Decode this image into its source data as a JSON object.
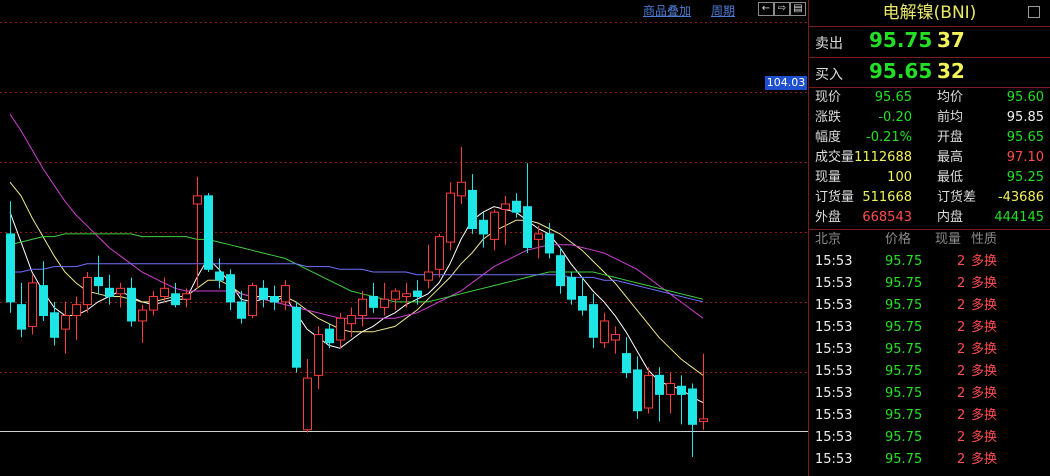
{
  "toolbar": {
    "overlay_label": "商品叠加",
    "period_label": "周期",
    "nav_buttons": [
      "←",
      "⇨",
      "▤"
    ]
  },
  "price_tag": "104.03",
  "quote": {
    "title": "电解镍(BNI)",
    "sell_label": "卖出",
    "sell_price": "95.75",
    "sell_vol": "37",
    "buy_label": "买入",
    "buy_price": "95.65",
    "buy_vol": "32"
  },
  "stats": [
    {
      "l1": "现价",
      "v1": "95.65",
      "c1": "green",
      "l2": "均价",
      "v2": "95.60",
      "c2": "green"
    },
    {
      "l1": "涨跌",
      "v1": "-0.20",
      "c1": "green",
      "l2": "前均",
      "v2": "95.85",
      "c2": "white"
    },
    {
      "l1": "幅度",
      "v1": "-0.21%",
      "c1": "green",
      "l2": "开盘",
      "v2": "95.65",
      "c2": "green"
    },
    {
      "l1": "成交量",
      "v1": "1112688",
      "c1": "yellow",
      "l2": "最高",
      "v2": "97.10",
      "c2": "red"
    },
    {
      "l1": "现量",
      "v1": "100",
      "c1": "yellow",
      "l2": "最低",
      "v2": "95.25",
      "c2": "green"
    },
    {
      "l1": "订货量",
      "v1": "511668",
      "c1": "yellow",
      "l2": "订货差",
      "v2": "-43686",
      "c2": "yellow"
    },
    {
      "l1": "外盘",
      "v1": "668543",
      "c1": "red",
      "l2": "内盘",
      "v2": "444145",
      "c2": "green"
    }
  ],
  "trades_header": {
    "time": "北京",
    "price": "价格",
    "vol": "现量",
    "type": "性质"
  },
  "trades": [
    {
      "time": "15:53",
      "price": "95.75",
      "vol": "2",
      "type": "多换"
    },
    {
      "time": "15:53",
      "price": "95.75",
      "vol": "2",
      "type": "多换"
    },
    {
      "time": "15:53",
      "price": "95.75",
      "vol": "2",
      "type": "多换"
    },
    {
      "time": "15:53",
      "price": "95.75",
      "vol": "2",
      "type": "多换"
    },
    {
      "time": "15:53",
      "price": "95.75",
      "vol": "2",
      "type": "多换"
    },
    {
      "time": "15:53",
      "price": "95.75",
      "vol": "2",
      "type": "多换"
    },
    {
      "time": "15:53",
      "price": "95.75",
      "vol": "2",
      "type": "多换"
    },
    {
      "time": "15:53",
      "price": "95.75",
      "vol": "2",
      "type": "多换"
    },
    {
      "time": "15:53",
      "price": "95.75",
      "vol": "2",
      "type": "多换"
    },
    {
      "time": "15:53",
      "price": "95.75",
      "vol": "2",
      "type": "多换"
    }
  ],
  "colors": {
    "up": "#ff3b3b",
    "down": "#1fe6e6",
    "ma5": "#ffffff",
    "ma10": "#f0e68c",
    "ma20": "#d040d0",
    "ma40": "#40d040",
    "ma60": "#7070ff"
  },
  "chart_data": {
    "type": "candlestick",
    "y_range": [
      88.5,
      106.0
    ],
    "reference_price": 104.03,
    "candles": [
      {
        "o": 97.4,
        "h": 98.6,
        "l": 94.5,
        "c": 94.9
      },
      {
        "o": 94.8,
        "h": 95.6,
        "l": 93.6,
        "c": 93.9
      },
      {
        "o": 94.0,
        "h": 95.9,
        "l": 93.7,
        "c": 95.6
      },
      {
        "o": 95.5,
        "h": 96.4,
        "l": 94.2,
        "c": 94.4
      },
      {
        "o": 94.5,
        "h": 94.9,
        "l": 93.3,
        "c": 93.6
      },
      {
        "o": 93.9,
        "h": 94.9,
        "l": 93.0,
        "c": 94.4
      },
      {
        "o": 94.4,
        "h": 95.1,
        "l": 93.5,
        "c": 94.8
      },
      {
        "o": 94.8,
        "h": 96.0,
        "l": 94.5,
        "c": 95.8
      },
      {
        "o": 95.8,
        "h": 96.6,
        "l": 95.2,
        "c": 95.5
      },
      {
        "o": 95.4,
        "h": 95.9,
        "l": 94.8,
        "c": 95.1
      },
      {
        "o": 95.2,
        "h": 95.6,
        "l": 94.7,
        "c": 95.4
      },
      {
        "o": 95.4,
        "h": 95.8,
        "l": 94.0,
        "c": 94.2
      },
      {
        "o": 94.2,
        "h": 94.8,
        "l": 93.4,
        "c": 94.6
      },
      {
        "o": 94.6,
        "h": 95.3,
        "l": 94.4,
        "c": 95.1
      },
      {
        "o": 95.1,
        "h": 95.8,
        "l": 94.9,
        "c": 95.4
      },
      {
        "o": 95.2,
        "h": 95.6,
        "l": 94.7,
        "c": 94.8
      },
      {
        "o": 95.0,
        "h": 95.4,
        "l": 94.7,
        "c": 95.2
      },
      {
        "o": 98.5,
        "h": 99.5,
        "l": 95.4,
        "c": 98.8
      },
      {
        "o": 98.8,
        "h": 98.9,
        "l": 96.0,
        "c": 96.1
      },
      {
        "o": 96.0,
        "h": 96.5,
        "l": 95.4,
        "c": 95.7
      },
      {
        "o": 95.9,
        "h": 96.1,
        "l": 94.6,
        "c": 94.9
      },
      {
        "o": 94.9,
        "h": 95.3,
        "l": 94.1,
        "c": 94.3
      },
      {
        "o": 94.4,
        "h": 95.6,
        "l": 94.3,
        "c": 95.5
      },
      {
        "o": 95.4,
        "h": 95.7,
        "l": 94.7,
        "c": 95.0
      },
      {
        "o": 95.1,
        "h": 95.5,
        "l": 94.6,
        "c": 94.9
      },
      {
        "o": 94.9,
        "h": 95.7,
        "l": 94.6,
        "c": 95.5
      },
      {
        "o": 94.7,
        "h": 94.9,
        "l": 92.3,
        "c": 92.5
      },
      {
        "o": 90.2,
        "h": 92.8,
        "l": 90.1,
        "c": 92.1
      },
      {
        "o": 92.2,
        "h": 94.0,
        "l": 91.7,
        "c": 93.7
      },
      {
        "o": 93.9,
        "h": 94.1,
        "l": 93.2,
        "c": 93.4
      },
      {
        "o": 93.5,
        "h": 94.5,
        "l": 93.2,
        "c": 94.3
      },
      {
        "o": 94.1,
        "h": 94.7,
        "l": 93.6,
        "c": 94.4
      },
      {
        "o": 94.4,
        "h": 95.3,
        "l": 94.0,
        "c": 95.0
      },
      {
        "o": 95.1,
        "h": 95.6,
        "l": 94.5,
        "c": 94.7
      },
      {
        "o": 94.7,
        "h": 95.6,
        "l": 94.4,
        "c": 95.0
      },
      {
        "o": 95.0,
        "h": 95.4,
        "l": 94.6,
        "c": 95.3
      },
      {
        "o": 95.1,
        "h": 95.6,
        "l": 94.7,
        "c": 95.2
      },
      {
        "o": 95.3,
        "h": 95.7,
        "l": 94.8,
        "c": 95.1
      },
      {
        "o": 95.7,
        "h": 97.0,
        "l": 95.4,
        "c": 96.0
      },
      {
        "o": 96.1,
        "h": 97.4,
        "l": 95.8,
        "c": 97.3
      },
      {
        "o": 97.1,
        "h": 99.3,
        "l": 96.8,
        "c": 98.9
      },
      {
        "o": 98.8,
        "h": 100.6,
        "l": 98.5,
        "c": 99.3
      },
      {
        "o": 99.0,
        "h": 99.6,
        "l": 97.4,
        "c": 97.6
      },
      {
        "o": 97.9,
        "h": 98.2,
        "l": 96.9,
        "c": 97.4
      },
      {
        "o": 97.2,
        "h": 98.3,
        "l": 96.8,
        "c": 98.2
      },
      {
        "o": 98.3,
        "h": 98.8,
        "l": 97.0,
        "c": 98.5
      },
      {
        "o": 98.6,
        "h": 98.9,
        "l": 98.0,
        "c": 98.2
      },
      {
        "o": 98.4,
        "h": 100.0,
        "l": 96.7,
        "c": 96.9
      },
      {
        "o": 97.2,
        "h": 97.7,
        "l": 96.5,
        "c": 97.4
      },
      {
        "o": 97.4,
        "h": 97.8,
        "l": 96.5,
        "c": 96.7
      },
      {
        "o": 96.6,
        "h": 96.9,
        "l": 95.2,
        "c": 95.5
      },
      {
        "o": 95.8,
        "h": 96.0,
        "l": 94.8,
        "c": 95.0
      },
      {
        "o": 95.1,
        "h": 95.8,
        "l": 94.4,
        "c": 94.6
      },
      {
        "o": 94.8,
        "h": 95.2,
        "l": 93.2,
        "c": 93.6
      },
      {
        "o": 93.4,
        "h": 94.5,
        "l": 93.2,
        "c": 94.2
      },
      {
        "o": 93.5,
        "h": 94.0,
        "l": 93.0,
        "c": 93.7
      },
      {
        "o": 93.0,
        "h": 93.6,
        "l": 92.1,
        "c": 92.3
      },
      {
        "o": 92.4,
        "h": 92.9,
        "l": 90.6,
        "c": 90.9
      },
      {
        "o": 91.0,
        "h": 92.5,
        "l": 90.8,
        "c": 92.2
      },
      {
        "o": 92.2,
        "h": 92.5,
        "l": 90.5,
        "c": 91.5
      },
      {
        "o": 91.5,
        "h": 92.3,
        "l": 90.8,
        "c": 91.9
      },
      {
        "o": 91.8,
        "h": 92.2,
        "l": 90.4,
        "c": 91.5
      },
      {
        "o": 91.7,
        "h": 91.9,
        "l": 89.2,
        "c": 90.4
      },
      {
        "o": 90.5,
        "h": 93.0,
        "l": 90.2,
        "c": 90.6
      }
    ],
    "ma_lines": [
      {
        "name": "MA5",
        "color_key": "ma5",
        "values": [
          98.2,
          97.1,
          96.0,
          95.3,
          94.7,
          94.4,
          94.4,
          94.6,
          94.9,
          95.1,
          95.3,
          95.1,
          94.9,
          94.8,
          94.9,
          95.0,
          95.0,
          95.8,
          96.5,
          96.1,
          95.6,
          95.0,
          94.9,
          95.0,
          94.9,
          95.1,
          94.5,
          93.9,
          93.6,
          93.3,
          93.2,
          93.5,
          93.8,
          94.0,
          94.3,
          94.5,
          94.8,
          95.0,
          95.2,
          95.6,
          96.3,
          97.2,
          97.9,
          98.2,
          98.4,
          98.3,
          98.2,
          97.9,
          97.6,
          97.4,
          96.9,
          96.3,
          95.8,
          95.3,
          94.9,
          94.4,
          93.8,
          93.1,
          92.4,
          92.0,
          91.8,
          91.7,
          91.4,
          91.2
        ]
      },
      {
        "name": "MA10",
        "color_key": "ma10",
        "values": [
          99.3,
          98.8,
          98.0,
          97.3,
          96.6,
          96.0,
          95.6,
          95.3,
          95.2,
          95.1,
          95.1,
          95.0,
          94.9,
          94.9,
          95.0,
          95.1,
          95.1,
          95.4,
          95.7,
          95.7,
          95.5,
          95.2,
          95.1,
          95.1,
          95.1,
          95.1,
          94.9,
          94.6,
          94.3,
          94.1,
          93.9,
          93.8,
          93.8,
          93.8,
          93.9,
          94.0,
          94.3,
          94.6,
          95.0,
          95.4,
          95.8,
          96.3,
          96.7,
          97.2,
          97.5,
          97.7,
          97.9,
          97.9,
          97.8,
          97.6,
          97.4,
          97.1,
          96.8,
          96.4,
          96.0,
          95.6,
          95.1,
          94.6,
          94.1,
          93.6,
          93.2,
          92.8,
          92.5,
          92.2
        ]
      },
      {
        "name": "MA20",
        "color_key": "ma20",
        "values": [
          101.8,
          101.2,
          100.5,
          99.8,
          99.2,
          98.6,
          98.1,
          97.7,
          97.3,
          96.9,
          96.6,
          96.3,
          96.0,
          95.8,
          95.6,
          95.4,
          95.3,
          95.3,
          95.3,
          95.3,
          95.3,
          95.2,
          95.1,
          95.0,
          94.9,
          94.8,
          94.7,
          94.6,
          94.5,
          94.4,
          94.3,
          94.3,
          94.3,
          94.3,
          94.3,
          94.3,
          94.4,
          94.5,
          94.7,
          94.9,
          95.1,
          95.3,
          95.6,
          95.9,
          96.2,
          96.4,
          96.6,
          96.8,
          96.9,
          97.0,
          97.0,
          97.0,
          96.9,
          96.8,
          96.7,
          96.5,
          96.3,
          96.1,
          95.8,
          95.5,
          95.2,
          94.9,
          94.6,
          94.3
        ]
      },
      {
        "name": "MA40",
        "color_key": "ma40",
        "values": [
          97.0,
          97.1,
          97.2,
          97.3,
          97.3,
          97.4,
          97.4,
          97.4,
          97.4,
          97.4,
          97.4,
          97.4,
          97.3,
          97.3,
          97.3,
          97.3,
          97.3,
          97.2,
          97.2,
          97.1,
          97.0,
          96.9,
          96.8,
          96.7,
          96.6,
          96.5,
          96.3,
          96.1,
          95.9,
          95.7,
          95.5,
          95.3,
          95.2,
          95.1,
          95.0,
          94.9,
          94.9,
          94.9,
          94.9,
          95.0,
          95.1,
          95.2,
          95.3,
          95.4,
          95.5,
          95.6,
          95.7,
          95.8,
          95.9,
          96.0,
          96.0,
          96.0,
          96.0,
          96.0,
          95.9,
          95.8,
          95.7,
          95.6,
          95.5,
          95.4,
          95.3,
          95.2,
          95.1,
          95.0
        ]
      },
      {
        "name": "MA60",
        "color_key": "ma60",
        "values": [
          96.0,
          96.0,
          96.1,
          96.1,
          96.2,
          96.2,
          96.2,
          96.3,
          96.3,
          96.3,
          96.3,
          96.3,
          96.3,
          96.3,
          96.3,
          96.3,
          96.3,
          96.3,
          96.3,
          96.3,
          96.3,
          96.3,
          96.3,
          96.3,
          96.3,
          96.3,
          96.3,
          96.2,
          96.2,
          96.2,
          96.1,
          96.1,
          96.1,
          96.0,
          96.0,
          96.0,
          96.0,
          95.9,
          95.9,
          95.9,
          95.9,
          95.9,
          95.9,
          95.9,
          95.9,
          95.9,
          95.9,
          95.9,
          95.9,
          95.9,
          95.9,
          95.8,
          95.8,
          95.8,
          95.7,
          95.7,
          95.6,
          95.5,
          95.4,
          95.3,
          95.2,
          95.1,
          95.0,
          94.9
        ]
      }
    ]
  }
}
